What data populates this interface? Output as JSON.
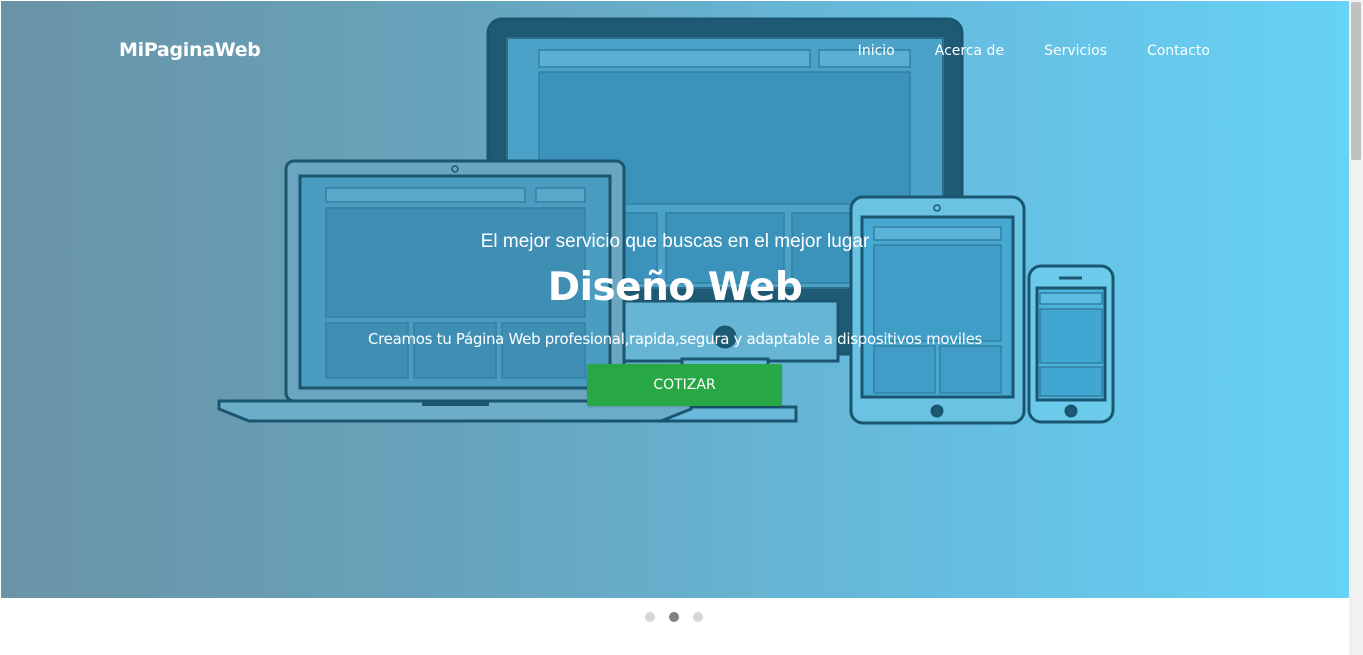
{
  "brand": "MiPaginaWeb",
  "nav": [
    "Inicio",
    "Acerca de",
    "Servicios",
    "Contacto"
  ],
  "hero": {
    "tagline": "El mejor servicio que buscas en el mejor lugar",
    "title": "Diseño Web",
    "subtitle": "Creamos tu Página Web profesional,rapida,segura y adaptable a dispositivos moviles",
    "cta_label": "COTIZAR"
  },
  "carousel": {
    "slide_count": 3,
    "active_index": 1
  },
  "colors": {
    "hero_gradient_start": "#6a93a6",
    "hero_gradient_end": "#66d2f6",
    "cta_background": "#28a745",
    "device_outline": "#1b5670",
    "indicator_active": "#7d8287",
    "indicator_inactive": "#d4d6d8"
  }
}
